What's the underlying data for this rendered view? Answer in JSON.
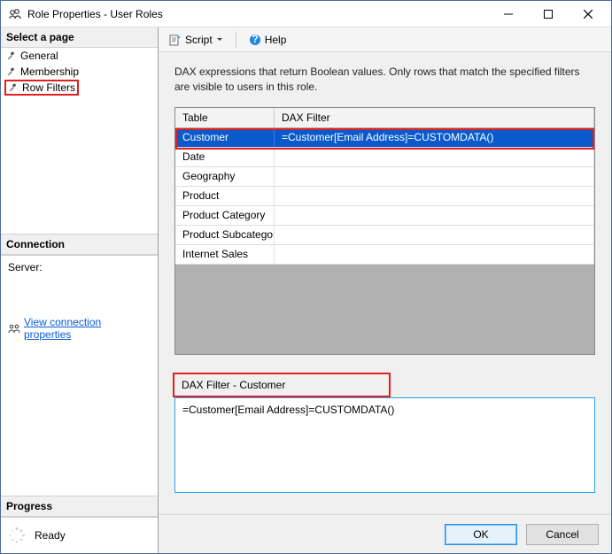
{
  "window": {
    "title": "Role Properties - User Roles"
  },
  "sidebar": {
    "select_page": "Select a page",
    "items": [
      {
        "label": "General"
      },
      {
        "label": "Membership"
      },
      {
        "label": "Row Filters"
      }
    ],
    "connection_header": "Connection",
    "server_label": "Server:",
    "view_conn_link": "View connection properties",
    "progress_header": "Progress",
    "ready_label": "Ready"
  },
  "toolbar": {
    "script": "Script",
    "help": "Help"
  },
  "main": {
    "description": "DAX expressions that return Boolean values. Only rows that match the specified filters are visible to users in this role.",
    "columns": {
      "table": "Table",
      "dax": "DAX Filter"
    },
    "rows": [
      {
        "table": "Customer",
        "dax": "=Customer[Email Address]=CUSTOMDATA()"
      },
      {
        "table": "Date",
        "dax": ""
      },
      {
        "table": "Geography",
        "dax": ""
      },
      {
        "table": "Product",
        "dax": ""
      },
      {
        "table": "Product Category",
        "dax": ""
      },
      {
        "table": "Product Subcategory",
        "dax": ""
      },
      {
        "table": "Internet Sales",
        "dax": ""
      }
    ],
    "filter_label": "DAX Filter - Customer",
    "filter_value": "=Customer[Email Address]=CUSTOMDATA()"
  },
  "footer": {
    "ok": "OK",
    "cancel": "Cancel"
  }
}
